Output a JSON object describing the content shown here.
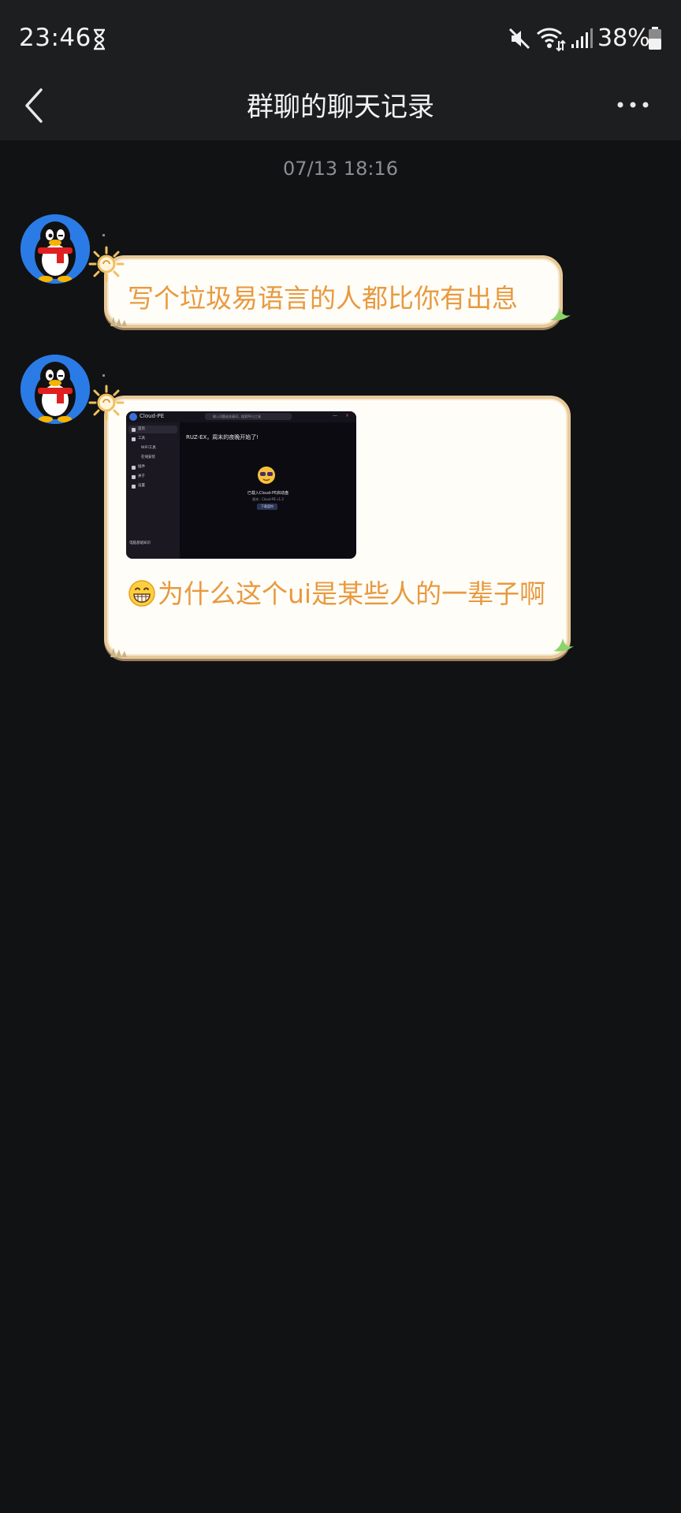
{
  "status_bar": {
    "time": "23:46",
    "battery": "38%",
    "icons": [
      "hourglass-icon",
      "mute-icon",
      "wifi-icon",
      "signal-icon",
      "battery-icon"
    ]
  },
  "header": {
    "title": "群聊的聊天记录",
    "icons": [
      "chevron-left-icon",
      "more-dots-icon"
    ]
  },
  "timestamp": "07/13 18:16",
  "messages": [
    {
      "avatar": "qq-penguin-avatar",
      "text": "写个垃圾易语言的人都比你有出息"
    },
    {
      "avatar": "qq-penguin-avatar",
      "emoji": "grinning-face-icon",
      "text": "为什么这个ui是某些人的一辈子啊",
      "image": {
        "app_name": "Cloud-PE",
        "search_placeholder": "输入问题或关键词，搜索PE与工具",
        "nav": [
          "首页",
          "工具",
          "WIFI工具",
          "在线安装",
          "插件",
          "关于",
          "设置"
        ],
        "footer": "电脑基础知识",
        "greeting": "RUZ-EX，周末的夜晚开始了!",
        "welcome": "已载入Cloud-PE启动盘",
        "subtitle": "版本：Cloud-PE v1.2",
        "button": "下载盘符"
      }
    }
  ],
  "colors": {
    "background": "#111214",
    "bar": "#1d1e20",
    "bubble_bg": "#fffdf8",
    "bubble_border": "#e8c99a",
    "bubble_text": "#e89a40",
    "avatar_bg": "#2b7be6"
  }
}
